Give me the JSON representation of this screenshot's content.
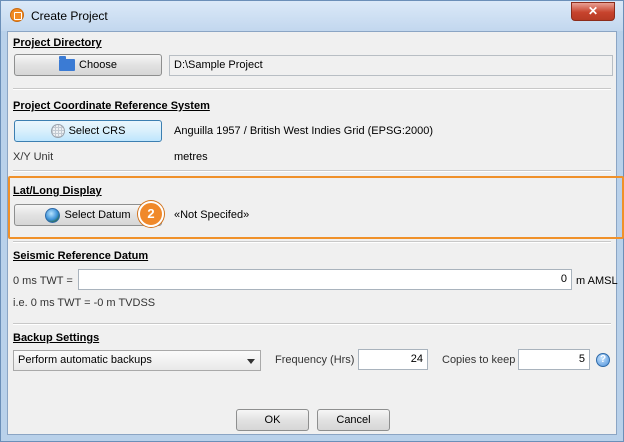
{
  "window": {
    "title": "Create Project",
    "close_glyph": "✕",
    "app_icon": "app-icon"
  },
  "project_directory": {
    "section_title": "Project Directory",
    "choose_label": "Choose",
    "choose_icon": "folder-icon",
    "path_value": "D:\\Sample Project"
  },
  "crs": {
    "section_title": "Project Coordinate Reference System",
    "select_label": "Select CRS",
    "select_icon": "globe-grid-icon",
    "crs_value": "Anguilla 1957 / British West Indies Grid (EPSG:2000)",
    "unit_label": "X/Y Unit",
    "unit_value": "metres"
  },
  "latlong": {
    "section_title": "Lat/Long Display",
    "select_label": "Select Datum",
    "select_icon": "globe-icon",
    "datum_value": "«Not Specifed»",
    "callout_number": "2",
    "highlight_color": "#f0912a"
  },
  "seismic": {
    "section_title": "Seismic Reference Datum",
    "twt_label": "0 ms TWT =",
    "twt_value": "0",
    "unit": "m AMSL",
    "note": "i.e. 0 ms TWT = -0 m TVDSS"
  },
  "backup": {
    "section_title": "Backup Settings",
    "mode_selected": "Perform automatic backups",
    "frequency_label": "Frequency (Hrs)",
    "frequency_value": "24",
    "copies_label": "Copies to keep",
    "copies_value": "5",
    "help_glyph": "?"
  },
  "footer": {
    "ok_label": "OK",
    "cancel_label": "Cancel"
  }
}
